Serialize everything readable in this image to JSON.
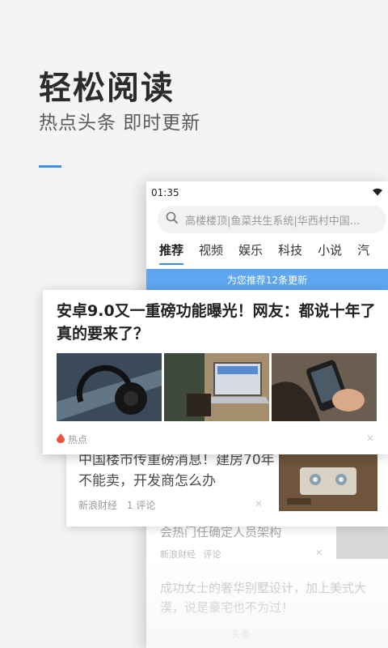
{
  "hero": {
    "title": "轻松阅读",
    "subtitle": "热点头条  即时更新"
  },
  "phone": {
    "status_time": "01:35",
    "search_placeholder": "高楼楼顶|鱼菜共生系统|华西村中国...",
    "tabs": [
      "推荐",
      "视频",
      "娱乐",
      "科技",
      "小说",
      "汽"
    ],
    "banner": "为您推荐12条更新"
  },
  "featured": {
    "headline": "安卓9.0又一重磅功能曝光！网友：都说十年了真的要来了？",
    "tag": "热点",
    "close": "✕"
  },
  "article2": {
    "title": "中国楼市传重磅消息！建房70年不能卖，开发商怎么办",
    "source": "新浪财经",
    "comments": "1 评论",
    "close": "✕"
  },
  "article3": {
    "title": "会热门任确定人员架构",
    "source": "新浪财经",
    "comments": "评论",
    "close": "✕"
  },
  "article4": {
    "title": "成功女士的奢华别墅设计，加上美式大漠，说是豪宅也不为过！",
    "source": "头条"
  },
  "colors": {
    "accent": "#3d8ee8",
    "banner": "#5ea6f0",
    "hot": "#e8553d"
  }
}
